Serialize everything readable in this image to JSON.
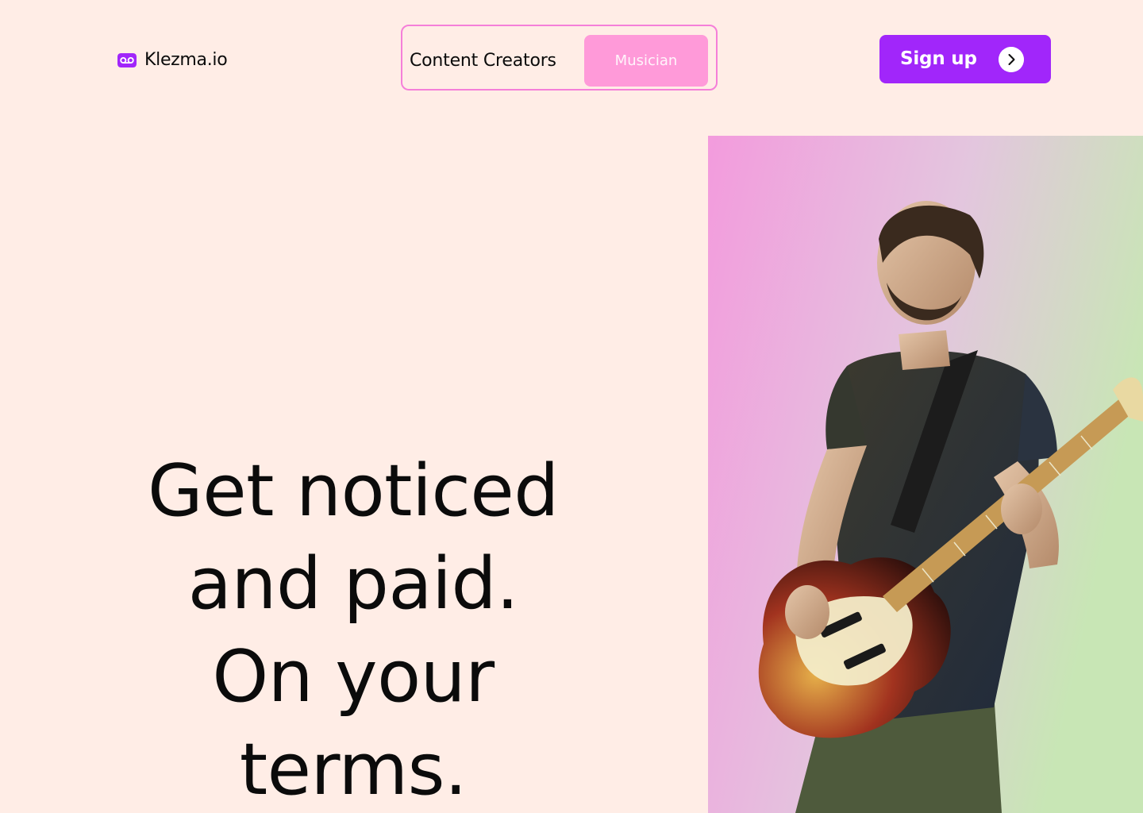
{
  "brand": {
    "name": "Klezma.io",
    "logo_icon": "voicemail-icon",
    "accent_color": "#A126FA"
  },
  "audience_switch": {
    "options": [
      {
        "label": "Content Creators",
        "selected": false
      },
      {
        "label": "Musician",
        "selected": true
      }
    ],
    "border_color": "#F57FD9",
    "selected_color": "#FF9AD9"
  },
  "cta": {
    "label": "Sign up",
    "icon": "chevron-right-icon",
    "color": "#A126FA"
  },
  "hero": {
    "headline_lines": [
      "Get noticed",
      "and paid.",
      "On your",
      "terms."
    ],
    "image": {
      "subject": "photo-of-bass-guitarist",
      "background_colors": [
        "#F39BDD",
        "#C8E6B5"
      ]
    }
  },
  "colors": {
    "page_background": "#FFEDE6",
    "text": "#0B0B0B"
  }
}
